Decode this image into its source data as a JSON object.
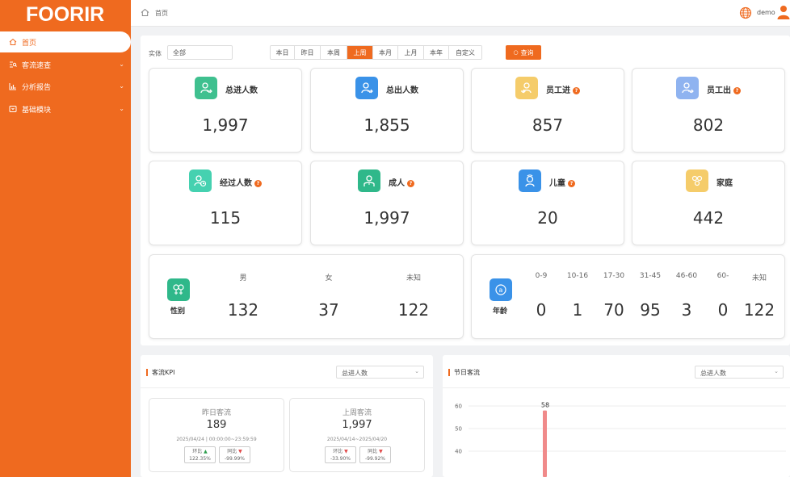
{
  "app": {
    "logo": "FOORIR"
  },
  "sidebar": {
    "items": [
      {
        "label": "首页",
        "active": true
      },
      {
        "label": "客流速查"
      },
      {
        "label": "分析报告"
      },
      {
        "label": "基础模块"
      }
    ]
  },
  "header": {
    "breadcrumb": "首页",
    "user": "demo"
  },
  "filter": {
    "label": "实体",
    "value": "全部",
    "ranges": [
      "本日",
      "昨日",
      "本周",
      "上周",
      "本月",
      "上月",
      "本年",
      "自定义"
    ],
    "selected_range": "上周",
    "query_label": "查询"
  },
  "cards": [
    {
      "title": "总进人数",
      "value": "1,997",
      "icon": "person-in-icon",
      "color": "#3fc08f",
      "help": false
    },
    {
      "title": "总出人数",
      "value": "1,855",
      "icon": "person-out-icon",
      "color": "#3a92e8",
      "help": false
    },
    {
      "title": "员工进",
      "value": "857",
      "icon": "staff-in-icon",
      "color": "#f5cc6a",
      "help": true
    },
    {
      "title": "员工出",
      "value": "802",
      "icon": "staff-out-icon",
      "color": "#8fb3f0",
      "help": true
    },
    {
      "title": "经过人数",
      "value": "115",
      "icon": "pass-by-icon",
      "color": "#45d1b0",
      "help": true
    },
    {
      "title": "成人",
      "value": "1,997",
      "icon": "adult-icon",
      "color": "#2fb88a",
      "help": true
    },
    {
      "title": "儿童",
      "value": "20",
      "icon": "child-icon",
      "color": "#3a92e8",
      "help": true
    },
    {
      "title": "家庭",
      "value": "442",
      "icon": "family-icon",
      "color": "#f5cc6a",
      "help": false
    }
  ],
  "gender": {
    "title": "性别",
    "items": [
      {
        "label": "男",
        "value": "132"
      },
      {
        "label": "女",
        "value": "37"
      },
      {
        "label": "未知",
        "value": "122"
      }
    ]
  },
  "age": {
    "title": "年龄",
    "items": [
      {
        "label": "0-9",
        "value": "0"
      },
      {
        "label": "10-16",
        "value": "1"
      },
      {
        "label": "17-30",
        "value": "70"
      },
      {
        "label": "31-45",
        "value": "95"
      },
      {
        "label": "46-60",
        "value": "3"
      },
      {
        "label": "60-",
        "value": "0"
      },
      {
        "label": "未知",
        "value": "122"
      }
    ]
  },
  "kpi_panel": {
    "title": "客流KPI",
    "select": "总进人数",
    "items": [
      {
        "title": "昨日客流",
        "value": "189",
        "date": "2025/04/24 | 00:00:00~23:59:59",
        "b1_label": "环比",
        "b1_dir": "up",
        "b1_value": "122.35%",
        "b2_label": "同比",
        "b2_dir": "down",
        "b2_value": "-99.99%"
      },
      {
        "title": "上周客流",
        "value": "1,997",
        "date": "2025/04/14~2025/04/20",
        "b1_label": "环比",
        "b1_dir": "down",
        "b1_value": "-33.90%",
        "b2_label": "同比",
        "b2_dir": "down",
        "b2_value": "-99.92%"
      }
    ]
  },
  "holiday_panel": {
    "title": "节日客流",
    "select": "总进人数",
    "y_ticks": [
      "60",
      "50",
      "40"
    ],
    "bar_label": "58"
  },
  "chart_data": {
    "type": "bar",
    "title": "节日客流",
    "xlabel": "",
    "ylabel": "",
    "ylim": [
      40,
      60
    ],
    "y_ticks": [
      40,
      50,
      60
    ],
    "series": [
      {
        "values": [
          58
        ]
      }
    ],
    "bar_color": "#f08a8a"
  }
}
